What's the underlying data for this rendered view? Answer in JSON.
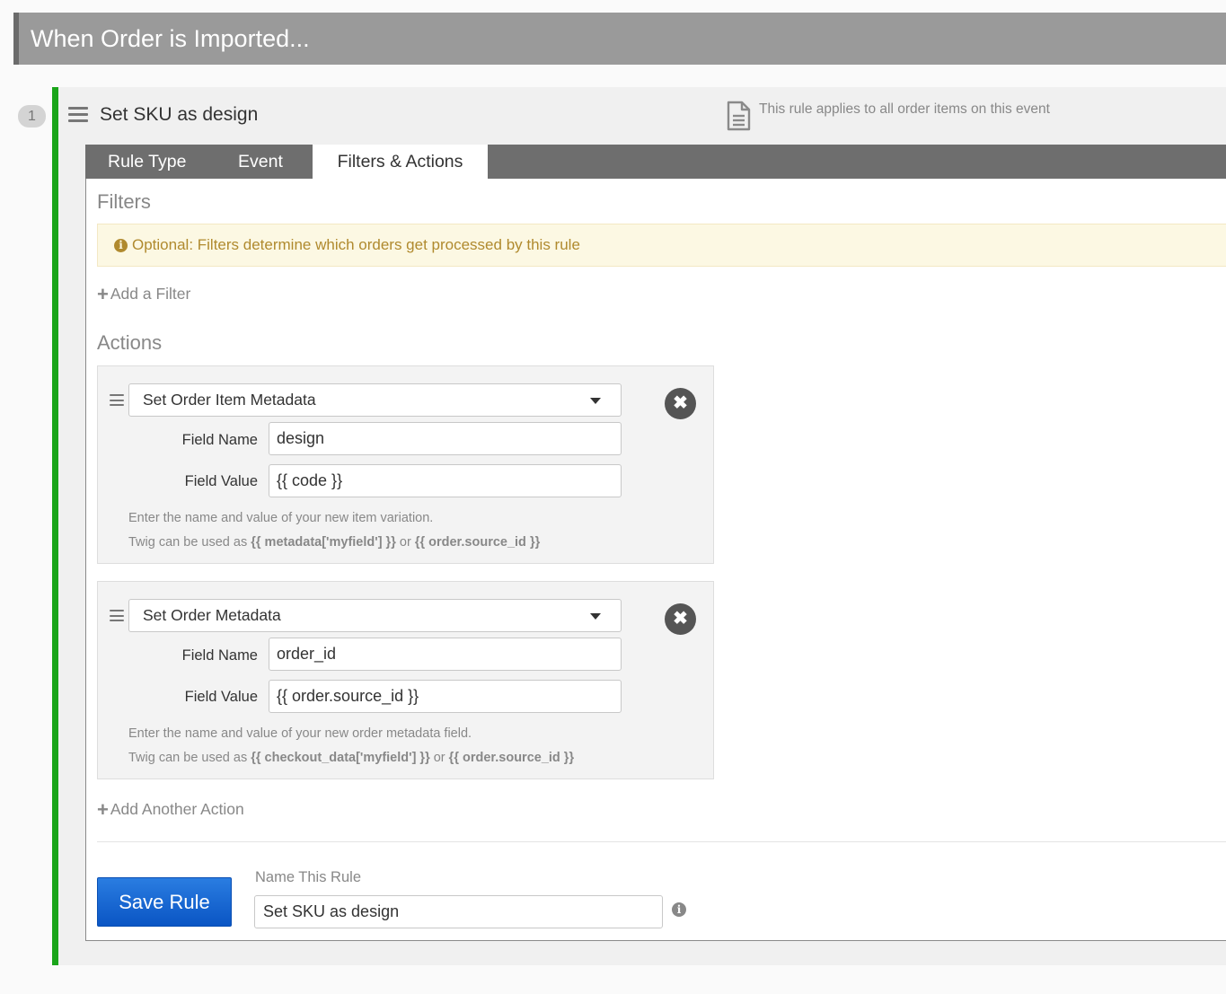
{
  "event": {
    "title": "When Order is Imported..."
  },
  "rule": {
    "number": "1",
    "title": "Set SKU as design",
    "applies_note": "This rule applies to all order items on this event"
  },
  "tabs": [
    {
      "label": "Rule Type"
    },
    {
      "label": "Event"
    },
    {
      "label": "Filters & Actions",
      "active": true
    }
  ],
  "filters": {
    "title": "Filters",
    "notice": "Optional: Filters determine which orders get processed by this rule",
    "add_label": "Add a Filter"
  },
  "actions": {
    "title": "Actions",
    "items": [
      {
        "type": "Set Order Item Metadata",
        "field_name_label": "Field Name",
        "field_name_value": "design",
        "field_value_label": "Field Value",
        "field_value_value": "{{ code }}",
        "help_line1": "Enter the name and value of your new item variation.",
        "help_prefix": "Twig can be used as ",
        "help_code1": "{{ metadata['myfield'] }}",
        "help_or": " or ",
        "help_code2": "{{ order.source_id }}"
      },
      {
        "type": "Set Order Metadata",
        "field_name_label": "Field Name",
        "field_name_value": "order_id",
        "field_value_label": "Field Value",
        "field_value_value": "{{ order.source_id }}",
        "help_line1": "Enter the name and value of your new order metadata field.",
        "help_prefix": "Twig can be used as ",
        "help_code1": "{{ checkout_data['myfield'] }}",
        "help_or": " or ",
        "help_code2": "{{ order.source_id }}"
      }
    ],
    "add_label": "Add Another Action"
  },
  "footer": {
    "save_label": "Save Rule",
    "name_label": "Name This Rule",
    "name_value": "Set SKU as design"
  },
  "colors": {
    "rule_accent": "#1aa51a",
    "save_button": "#0a55c4",
    "notice_text": "#b08a2e"
  }
}
